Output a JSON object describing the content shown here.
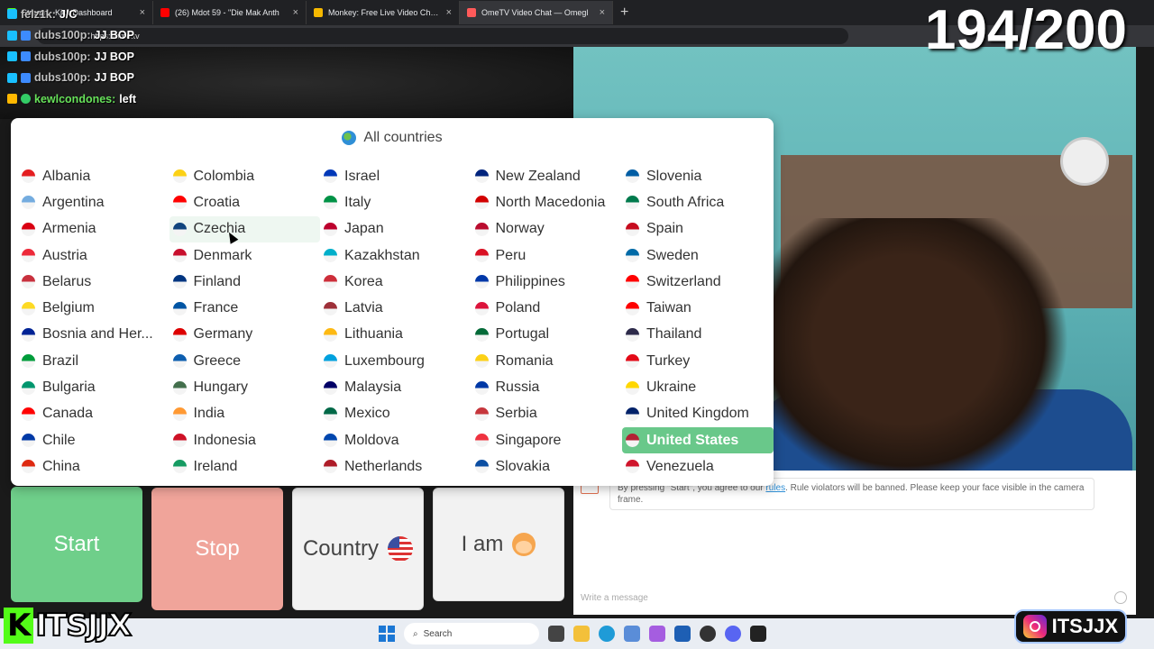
{
  "browser": {
    "tabs": [
      {
        "title": "Stream - Kick Dashboard",
        "color": "#53fc18"
      },
      {
        "title": "(26) Mdot 59 - \"Die Mak Anth",
        "color": "#ff0000"
      },
      {
        "title": "Monkey: Free Live Video Chat to M",
        "color": "#f5b800"
      },
      {
        "title": "OmeTV Video Chat — Omegl",
        "color": "#ff5a5a"
      }
    ],
    "url": "https://ome.tv"
  },
  "stream_overlay": {
    "counter": "194/200",
    "chat": [
      {
        "user": "felz1k:",
        "msg": "J/C"
      },
      {
        "user": "dubs100p:",
        "msg": "JJ BOP"
      },
      {
        "user": "dubs100p:",
        "msg": "JJ BOP"
      },
      {
        "user": "dubs100p:",
        "msg": "JJ BOP"
      },
      {
        "user": "kewlcondones:",
        "msg": "left"
      }
    ],
    "left_logo_k": "K",
    "left_logo_text": "ITSJJX",
    "right_logo_text": "ITSJJX"
  },
  "country_popup": {
    "title": "All countries",
    "selected": "United States",
    "hovered": "Czechia",
    "countries": [
      {
        "name": "Albania",
        "color": "#e41e20"
      },
      {
        "name": "Argentina",
        "color": "#74acdf"
      },
      {
        "name": "Armenia",
        "color": "#d90012"
      },
      {
        "name": "Austria",
        "color": "#ed2939"
      },
      {
        "name": "Belarus",
        "color": "#c8313e"
      },
      {
        "name": "Belgium",
        "color": "#fdda24"
      },
      {
        "name": "Bosnia and Her...",
        "color": "#002395"
      },
      {
        "name": "Brazil",
        "color": "#009c3b"
      },
      {
        "name": "Bulgaria",
        "color": "#00966e"
      },
      {
        "name": "Canada",
        "color": "#ff0000"
      },
      {
        "name": "Chile",
        "color": "#0039a6"
      },
      {
        "name": "China",
        "color": "#de2910"
      },
      {
        "name": "Colombia",
        "color": "#fcd116"
      },
      {
        "name": "Croatia",
        "color": "#ff0000"
      },
      {
        "name": "Czechia",
        "color": "#11457e"
      },
      {
        "name": "Denmark",
        "color": "#c8102e"
      },
      {
        "name": "Finland",
        "color": "#003580"
      },
      {
        "name": "France",
        "color": "#0055a4"
      },
      {
        "name": "Germany",
        "color": "#dd0000"
      },
      {
        "name": "Greece",
        "color": "#0d5eaf"
      },
      {
        "name": "Hungary",
        "color": "#436f4d"
      },
      {
        "name": "India",
        "color": "#ff9933"
      },
      {
        "name": "Indonesia",
        "color": "#ce1126"
      },
      {
        "name": "Ireland",
        "color": "#169b62"
      },
      {
        "name": "Israel",
        "color": "#0038b8"
      },
      {
        "name": "Italy",
        "color": "#009246"
      },
      {
        "name": "Japan",
        "color": "#bc002d"
      },
      {
        "name": "Kazakhstan",
        "color": "#00afca"
      },
      {
        "name": "Korea",
        "color": "#cd2e3a"
      },
      {
        "name": "Latvia",
        "color": "#9e3039"
      },
      {
        "name": "Lithuania",
        "color": "#fdb913"
      },
      {
        "name": "Luxembourg",
        "color": "#00a1de"
      },
      {
        "name": "Malaysia",
        "color": "#010066"
      },
      {
        "name": "Mexico",
        "color": "#006847"
      },
      {
        "name": "Moldova",
        "color": "#0046ae"
      },
      {
        "name": "Netherlands",
        "color": "#ae1c28"
      },
      {
        "name": "New Zealand",
        "color": "#00247d"
      },
      {
        "name": "North Macedonia",
        "color": "#d20000"
      },
      {
        "name": "Norway",
        "color": "#ba0c2f"
      },
      {
        "name": "Peru",
        "color": "#d91023"
      },
      {
        "name": "Philippines",
        "color": "#0038a8"
      },
      {
        "name": "Poland",
        "color": "#dc143c"
      },
      {
        "name": "Portugal",
        "color": "#046a38"
      },
      {
        "name": "Romania",
        "color": "#fcd116"
      },
      {
        "name": "Russia",
        "color": "#0039a6"
      },
      {
        "name": "Serbia",
        "color": "#c6363c"
      },
      {
        "name": "Singapore",
        "color": "#ef3340"
      },
      {
        "name": "Slovakia",
        "color": "#0b4ea2"
      },
      {
        "name": "Slovenia",
        "color": "#005da4"
      },
      {
        "name": "South Africa",
        "color": "#007a4d"
      },
      {
        "name": "Spain",
        "color": "#c60b1e"
      },
      {
        "name": "Sweden",
        "color": "#006aa7"
      },
      {
        "name": "Switzerland",
        "color": "#ff0000"
      },
      {
        "name": "Taiwan",
        "color": "#fe0000"
      },
      {
        "name": "Thailand",
        "color": "#2d2a4a"
      },
      {
        "name": "Turkey",
        "color": "#e30a17"
      },
      {
        "name": "Ukraine",
        "color": "#ffd700"
      },
      {
        "name": "United Kingdom",
        "color": "#012169"
      },
      {
        "name": "United States",
        "color": "#b22234"
      },
      {
        "name": "Venezuela",
        "color": "#cf142b"
      }
    ]
  },
  "controls": {
    "start": "Start",
    "stop": "Stop",
    "country": "Country",
    "iam": "I am"
  },
  "messages": {
    "notice_pre": "By pressing \"Start\", you agree to our",
    "notice_link": "rules",
    "notice_post": ". Rule violators will be banned. Please keep your face visible in the camera frame.",
    "input_placeholder": "Write a message"
  },
  "taskbar": {
    "search_label": "Search"
  },
  "colors": {
    "start_green": "#6fcf8a",
    "stop_red": "#f0a49a",
    "selected_green": "#69c88a"
  }
}
